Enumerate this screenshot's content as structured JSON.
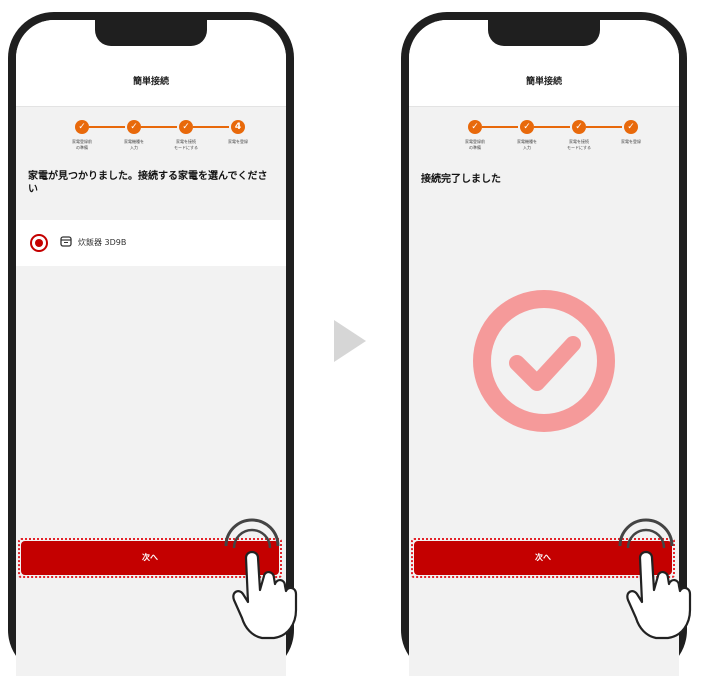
{
  "left_screen": {
    "title": "簡単接続",
    "steps": [
      {
        "indicator": "✓",
        "label": "家電登録前\nの準備"
      },
      {
        "indicator": "✓",
        "label": "家電機種を\n入力"
      },
      {
        "indicator": "✓",
        "label": "家電を接続\nモードにする"
      },
      {
        "indicator": "4",
        "label": "家電を登録"
      }
    ],
    "instruction": "家電が見つかりました。接続する家電を選んでください",
    "device_name": "炊飯器 3D9B",
    "next_button": "次へ"
  },
  "right_screen": {
    "title": "簡単接続",
    "steps": [
      {
        "indicator": "✓",
        "label": "家電登録前\nの準備"
      },
      {
        "indicator": "✓",
        "label": "家電機種を\n入力"
      },
      {
        "indicator": "✓",
        "label": "家電を接続\nモードにする"
      },
      {
        "indicator": "✓",
        "label": "家電を登録"
      }
    ],
    "message": "接続完了しました",
    "next_button": "次へ"
  },
  "icons": {
    "step_done": "check-icon",
    "device": "rice-cooker-icon",
    "transition": "triangle-right-icon",
    "success": "check-circle-icon",
    "gesture": "hand-tap-icon"
  },
  "colors": {
    "accent": "#c40000",
    "step": "#e8690b",
    "success": "#f59a9a"
  }
}
